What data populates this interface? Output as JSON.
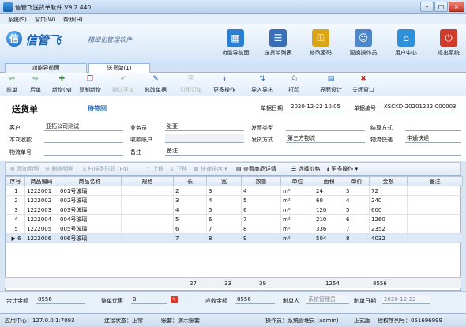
{
  "window": {
    "title": "信管飞送货单软件 V9.2.440",
    "minimize": "–",
    "maximize": "□",
    "close": "×"
  },
  "menu": [
    "系统(S)",
    "窗口(W)",
    "帮助(H)"
  ],
  "brand": {
    "name": "信管飞",
    "slogan": "· 精细化管理软件"
  },
  "top_buttons": [
    {
      "label": "功能导航面",
      "icon": "navigation-icon",
      "color": "#2a7fd0",
      "glyph": "▦"
    },
    {
      "label": "送货单列表",
      "icon": "list-icon",
      "color": "#3a6fb5",
      "glyph": "☰"
    },
    {
      "label": "修改密码",
      "icon": "lock-icon",
      "color": "#d9a417",
      "glyph": "⚿"
    },
    {
      "label": "更换操作员",
      "icon": "users-icon",
      "color": "#4d87c9",
      "glyph": "☺"
    },
    {
      "label": "用户中心",
      "icon": "user-center-icon",
      "color": "#2f8fd8",
      "glyph": "⌂"
    },
    {
      "label": "退出系统",
      "icon": "power-icon",
      "color": "#d23b2c",
      "glyph": "⏻"
    }
  ],
  "tabs": [
    {
      "label": "功能导航面"
    },
    {
      "label": "送货单(1)"
    }
  ],
  "toolbar": [
    {
      "label": "前单",
      "glyph": "⇦",
      "icon": "prev-icon",
      "color": "#2c8a3a",
      "enabled": true
    },
    {
      "label": "后单",
      "glyph": "⇨",
      "icon": "next-icon",
      "color": "#2c8a3a",
      "enabled": true
    },
    {
      "label": "新增(N)",
      "glyph": "✚",
      "icon": "add-icon",
      "color": "#2c8a3a",
      "enabled": true
    },
    {
      "label": "复制新增",
      "glyph": "❐",
      "icon": "copy-add-icon",
      "color": "#b33",
      "enabled": true
    },
    {
      "label": "确认开单",
      "glyph": "✔",
      "icon": "confirm-icon",
      "color": "#999",
      "enabled": false
    },
    {
      "label": "修改单据",
      "glyph": "✎",
      "icon": "edit-icon",
      "color": "#1b5fb0",
      "enabled": true
    },
    {
      "label": "引用订单",
      "glyph": "⎘",
      "icon": "reference-icon",
      "color": "#999",
      "enabled": false
    },
    {
      "label": "更多操作",
      "glyph": "⯯",
      "icon": "more-icon",
      "color": "#1b5fb0",
      "enabled": true
    },
    {
      "label": "导入导出",
      "glyph": "⇅",
      "icon": "import-export-icon",
      "color": "#1b5fb0",
      "enabled": true
    },
    {
      "label": "打印",
      "glyph": "⎙",
      "icon": "print-icon",
      "color": "#355",
      "enabled": true
    },
    {
      "label": "界面设计",
      "glyph": "▤",
      "icon": "design-icon",
      "color": "#1b5fb0",
      "enabled": true
    },
    {
      "label": "关闭窗口",
      "glyph": "✖",
      "icon": "close-window-icon",
      "color": "#c22",
      "enabled": true
    }
  ],
  "doc": {
    "title": "送货单",
    "status": "待签回",
    "date_label": "单据日期",
    "date": "2020-12-22 10:05",
    "no_label": "单据编号",
    "no": "XSCKD-20201222-000003"
  },
  "form": {
    "customer_label": "客户",
    "customer": "亚拓公司测试",
    "salesman_label": "业务员",
    "salesman": "张亚",
    "invoice_type_label": "发票类型",
    "invoice_type": "",
    "settlement_label": "结算方式",
    "settlement": "",
    "received_label": "本次收款",
    "received": "",
    "account_label": "收款账户",
    "account": "",
    "ship_method_label": "发货方式",
    "ship_method": "第三方物流",
    "logistics_label": "物流快递",
    "logistics": "申通快递",
    "tracking_label": "物流单号",
    "tracking": "",
    "remark_label": "备注",
    "remark": "备注"
  },
  "grid_toolbar": [
    {
      "label": "⊕ 添加明细",
      "enabled": false
    },
    {
      "label": "⊖ 删除明细",
      "enabled": false
    },
    {
      "label": "⌸ 扫描条形码 (F4)",
      "enabled": false
    },
    {
      "label": "↑ 上移",
      "enabled": false
    },
    {
      "label": "↓ 下移",
      "enabled": false
    },
    {
      "label": "▦ 快速排序 ▾",
      "enabled": false
    },
    {
      "label": "▤ 查看商品详情",
      "enabled": true
    },
    {
      "label": "☰ 选择价格",
      "enabled": true
    },
    {
      "label": "⯯ 更多操作 ▾",
      "enabled": true
    }
  ],
  "table": {
    "columns": [
      "序号",
      "商品编码",
      "商品名称",
      "规格",
      "长",
      "宽",
      "数量",
      "单位",
      "面积",
      "单价",
      "金额",
      "备注"
    ],
    "rows": [
      [
        "1",
        "1222001",
        "001号玻璃",
        "",
        "2",
        "3",
        "4",
        "m²",
        "24",
        "3",
        "72",
        ""
      ],
      [
        "2",
        "1222002",
        "002号玻璃",
        "",
        "3",
        "4",
        "5",
        "m²",
        "60",
        "4",
        "240",
        ""
      ],
      [
        "3",
        "1222003",
        "003号玻璃",
        "",
        "4",
        "5",
        "6",
        "m²",
        "120",
        "5",
        "600",
        ""
      ],
      [
        "4",
        "1222004",
        "004号玻璃",
        "",
        "5",
        "6",
        "7",
        "m²",
        "210",
        "6",
        "1260",
        ""
      ],
      [
        "5",
        "1222005",
        "005号玻璃",
        "",
        "6",
        "7",
        "8",
        "m²",
        "336",
        "7",
        "2352",
        ""
      ],
      [
        "6",
        "1222006",
        "006号玻璃",
        "",
        "7",
        "8",
        "9",
        "m²",
        "504",
        "8",
        "4032",
        ""
      ]
    ],
    "sel_marker": "▶",
    "totals": {
      "length": "27",
      "width": "33",
      "qty": "39",
      "area": "1254",
      "amount": "8556"
    }
  },
  "footer": {
    "total_label": "合计金额",
    "total": "8556",
    "discount_label": "整单优惠",
    "discount": "0",
    "receivable_label": "应收金额",
    "receivable": "8556",
    "maker_label": "制单人",
    "maker": "系统管理员",
    "make_date_label": "制单日期",
    "make_date": "2020-12-22"
  },
  "status": {
    "app_center": "应用中心：127.0.0.1:7093",
    "connection": "连接状态：正常",
    "book": "账套：演示账套",
    "operator": "操作员：系统管理员 (admin)",
    "edition": "正式版",
    "license": "授权序列号：051696999"
  }
}
